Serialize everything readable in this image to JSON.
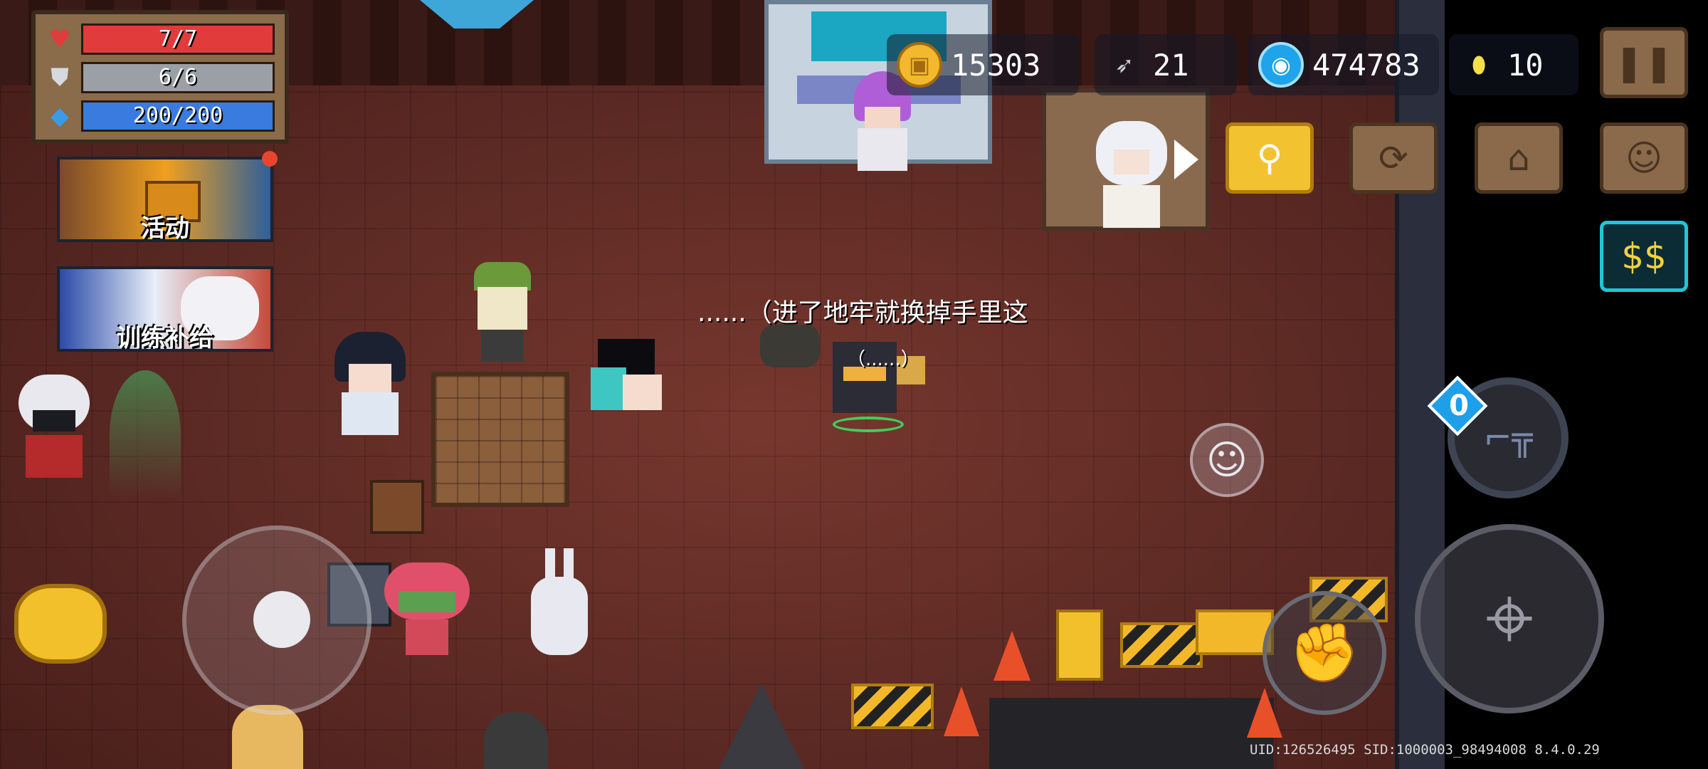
{
  "stats": {
    "health": {
      "text": "7/7",
      "fraction": 1.0,
      "color": "#e23b3b"
    },
    "armor": {
      "text": "6/6",
      "fraction": 1.0,
      "color": "#9aa0a6"
    },
    "energy": {
      "text": "200/200",
      "fraction": 1.0,
      "color": "#3a7be0"
    }
  },
  "banners": {
    "event_label": "活动",
    "training_label": "训练补给"
  },
  "currency": {
    "gold": "15303",
    "fish": "21",
    "gems": "474783",
    "tokens": "10"
  },
  "chat": {
    "npc_line": "......（进了地牢就换掉手里这",
    "player_line": "（......）"
  },
  "controls": {
    "weapon_swap_count": "0"
  },
  "footer": {
    "uid_text": "UID:126526495 SID:1000003_98494008 8.4.0.29"
  },
  "colors": {
    "floor": "#6b302a",
    "gold_coin": "#f2b92e",
    "gem": "#1fa3ea",
    "token": "#f5e04a",
    "map_button": "#f2c230",
    "shop_button_accent": "#1cc7d8"
  }
}
